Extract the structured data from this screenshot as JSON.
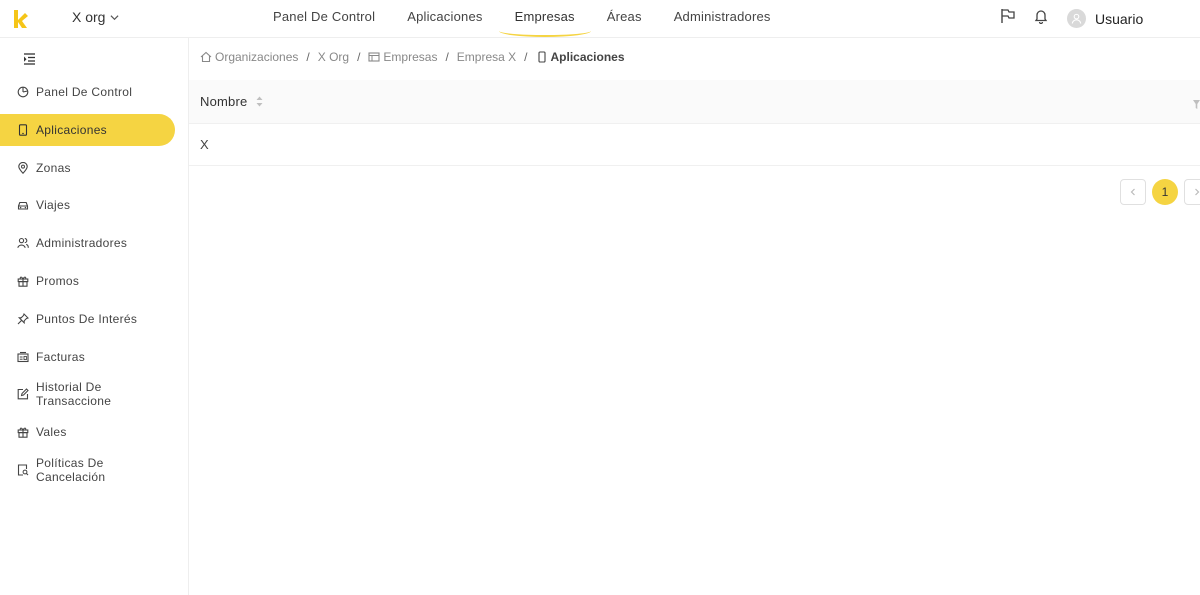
{
  "header": {
    "org_name": "X org",
    "nav": [
      {
        "label": "Panel De Control",
        "active": false
      },
      {
        "label": "Aplicaciones",
        "active": false
      },
      {
        "label": "Empresas",
        "active": true
      },
      {
        "label": "Áreas",
        "active": false
      },
      {
        "label": "Administradores",
        "active": false
      }
    ],
    "user_name": "Usuario"
  },
  "sidebar": {
    "items": [
      {
        "label": "Panel De Control",
        "icon": "pie-chart-icon",
        "active": false
      },
      {
        "label": "Aplicaciones",
        "icon": "mobile-icon",
        "active": true
      },
      {
        "label": "Zonas",
        "icon": "location-pin-icon",
        "active": false
      },
      {
        "label": "Viajes",
        "icon": "car-icon",
        "active": false
      },
      {
        "label": "Administradores",
        "icon": "users-icon",
        "active": false
      },
      {
        "label": "Promos",
        "icon": "gift-icon",
        "active": false
      },
      {
        "label": "Puntos De Interés",
        "icon": "pushpin-icon",
        "active": false
      },
      {
        "label": "Facturas",
        "icon": "invoice-icon",
        "active": false
      },
      {
        "label": "Historial De Transaccione",
        "icon": "edit-icon",
        "active": false
      },
      {
        "label": "Vales",
        "icon": "gift-icon",
        "active": false
      },
      {
        "label": "Políticas De Cancelación",
        "icon": "file-search-icon",
        "active": false
      }
    ]
  },
  "breadcrumb": [
    {
      "label": "Organizaciones",
      "icon": "home-icon"
    },
    {
      "label": "X Org",
      "icon": ""
    },
    {
      "label": "Empresas",
      "icon": "building-icon"
    },
    {
      "label": "Empresa X",
      "icon": ""
    },
    {
      "label": "Aplicaciones",
      "icon": "mobile-icon"
    }
  ],
  "table": {
    "columns": [
      "Nombre"
    ],
    "rows": [
      [
        "X"
      ]
    ]
  },
  "pagination": {
    "current_page": "1"
  },
  "colors": {
    "accent": "#f5d442"
  }
}
